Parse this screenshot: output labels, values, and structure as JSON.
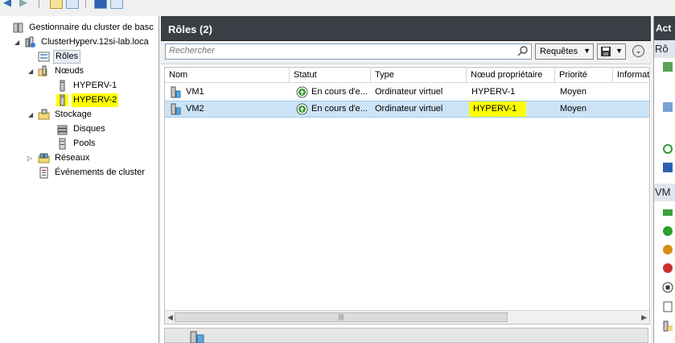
{
  "tree": {
    "root": "Gestionnaire du cluster de basc",
    "cluster": "ClusterHyperv.12si-lab.loca",
    "roles": "Rôles",
    "nodes": "Nœuds",
    "node1": "HYPERV-1",
    "node2": "HYPERV-2",
    "storage": "Stockage",
    "disks": "Disques",
    "pools": "Pools",
    "networks": "Réseaux",
    "events": "Événements de cluster"
  },
  "center": {
    "title": "Rôles (2)",
    "search_placeholder": "Rechercher",
    "requests_label": "Requêtes",
    "columns": [
      "Nom",
      "Statut",
      "Type",
      "Nœud propriétaire",
      "Priorité",
      "Informati"
    ],
    "rows": [
      {
        "name": "VM1",
        "status": "En cours d'e...",
        "type": "Ordinateur virtuel",
        "owner": "HYPERV-1",
        "priority": "Moyen"
      },
      {
        "name": "VM2",
        "status": "En cours d'e...",
        "type": "Ordinateur virtuel",
        "owner": "HYPERV-1",
        "priority": "Moyen"
      }
    ]
  },
  "actions": {
    "title": "Act",
    "section1": "Rô",
    "section2": "VM"
  },
  "colors": {
    "header_bg": "#3a3f45",
    "highlight": "#ffff00",
    "selected_row": "#cce4f7"
  }
}
